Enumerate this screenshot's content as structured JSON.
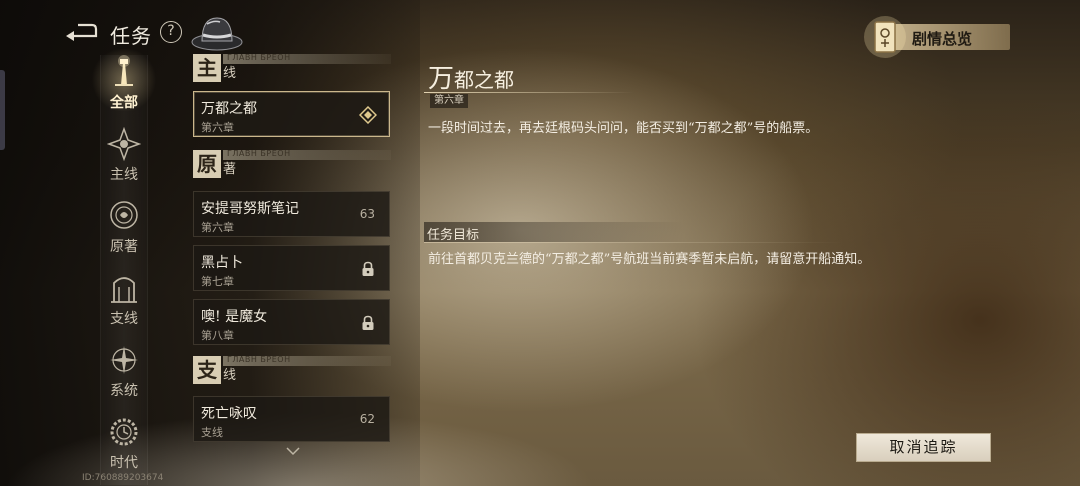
{
  "header": {
    "title": "任务",
    "help_label": "?"
  },
  "categories": [
    {
      "label": "全部",
      "icon": "lighthouse-icon",
      "active": true
    },
    {
      "label": "主线",
      "icon": "compass-star-icon",
      "active": false
    },
    {
      "label": "原著",
      "icon": "medallion-icon",
      "active": false
    },
    {
      "label": "支线",
      "icon": "archway-icon",
      "active": false
    },
    {
      "label": "系统",
      "icon": "star-compass-icon",
      "active": false
    },
    {
      "label": "时代",
      "icon": "gear-clock-icon",
      "active": false
    }
  ],
  "player_id": "ID:760889203674",
  "quest_list": {
    "sections": [
      {
        "big": "主",
        "small": "线",
        "band": "ГЛАВН БРЕОН"
      },
      {
        "big": "原",
        "small": "著",
        "band": "ГЛАВН БРЕОН"
      },
      {
        "big": "支",
        "small": "线",
        "band": "ГЛАВН БРЕОН"
      }
    ],
    "items": [
      {
        "name": "万都之都",
        "sub": "第六章",
        "right": "",
        "state": "tracked"
      },
      {
        "name": "安提哥努斯笔记",
        "sub": "第六章",
        "right": "63",
        "state": "level"
      },
      {
        "name": "黑占卜",
        "sub": "第七章",
        "right": "",
        "state": "locked"
      },
      {
        "name": "噢! 是魔女",
        "sub": "第八章",
        "right": "",
        "state": "locked"
      },
      {
        "name": "死亡咏叹",
        "sub": "支线",
        "right": "62",
        "state": "level"
      }
    ]
  },
  "detail": {
    "title_first": "万",
    "title_rest": "都之都",
    "chapter": "第六章",
    "description": "一段时间过去，再去廷根码头问问，能否买到“万都之都”号的船票。",
    "objective_label": "任务目标",
    "objective_text": "前往首都贝克兰德的“万都之都”号航班当前赛季暂未启航，请留意开船通知。"
  },
  "overview_button": {
    "label": "剧情总览",
    "icon": "scroll-card-icon"
  },
  "cancel_button": {
    "label": "取消追踪"
  },
  "colors": {
    "accent": "#cbb78c",
    "button_bg": "#e9e1d1"
  }
}
